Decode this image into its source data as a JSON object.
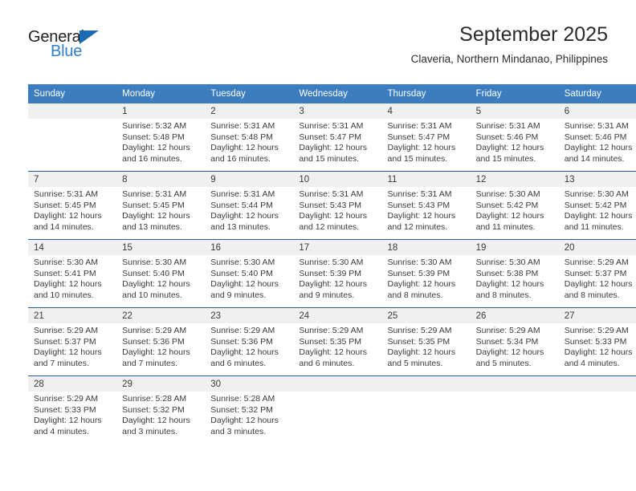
{
  "logo": {
    "word_top": "General",
    "word_bottom": "Blue",
    "triangle_color": "#1b6ab3",
    "text_color": "#231f20",
    "blue_color": "#2f7fc7"
  },
  "header": {
    "title": "September 2025",
    "subtitle": "Claveria, Northern Mindanao, Philippines"
  },
  "theme": {
    "header_bg": "#3b7dbf",
    "row_border": "#2a6099",
    "daynum_bg": "#f0f0f0",
    "text": "#3a3a3a"
  },
  "calendar": {
    "weekdays": [
      "Sunday",
      "Monday",
      "Tuesday",
      "Wednesday",
      "Thursday",
      "Friday",
      "Saturday"
    ],
    "labels": {
      "sunrise": "Sunrise:",
      "sunset": "Sunset:",
      "daylight": "Daylight:"
    },
    "weeks": [
      [
        {
          "day": "",
          "sunrise": "",
          "sunset": "",
          "daylight_line1": "",
          "daylight_line2": ""
        },
        {
          "day": "1",
          "sunrise": "Sunrise: 5:32 AM",
          "sunset": "Sunset: 5:48 PM",
          "daylight_line1": "Daylight: 12 hours",
          "daylight_line2": "and 16 minutes."
        },
        {
          "day": "2",
          "sunrise": "Sunrise: 5:31 AM",
          "sunset": "Sunset: 5:48 PM",
          "daylight_line1": "Daylight: 12 hours",
          "daylight_line2": "and 16 minutes."
        },
        {
          "day": "3",
          "sunrise": "Sunrise: 5:31 AM",
          "sunset": "Sunset: 5:47 PM",
          "daylight_line1": "Daylight: 12 hours",
          "daylight_line2": "and 15 minutes."
        },
        {
          "day": "4",
          "sunrise": "Sunrise: 5:31 AM",
          "sunset": "Sunset: 5:47 PM",
          "daylight_line1": "Daylight: 12 hours",
          "daylight_line2": "and 15 minutes."
        },
        {
          "day": "5",
          "sunrise": "Sunrise: 5:31 AM",
          "sunset": "Sunset: 5:46 PM",
          "daylight_line1": "Daylight: 12 hours",
          "daylight_line2": "and 15 minutes."
        },
        {
          "day": "6",
          "sunrise": "Sunrise: 5:31 AM",
          "sunset": "Sunset: 5:46 PM",
          "daylight_line1": "Daylight: 12 hours",
          "daylight_line2": "and 14 minutes."
        }
      ],
      [
        {
          "day": "7",
          "sunrise": "Sunrise: 5:31 AM",
          "sunset": "Sunset: 5:45 PM",
          "daylight_line1": "Daylight: 12 hours",
          "daylight_line2": "and 14 minutes."
        },
        {
          "day": "8",
          "sunrise": "Sunrise: 5:31 AM",
          "sunset": "Sunset: 5:45 PM",
          "daylight_line1": "Daylight: 12 hours",
          "daylight_line2": "and 13 minutes."
        },
        {
          "day": "9",
          "sunrise": "Sunrise: 5:31 AM",
          "sunset": "Sunset: 5:44 PM",
          "daylight_line1": "Daylight: 12 hours",
          "daylight_line2": "and 13 minutes."
        },
        {
          "day": "10",
          "sunrise": "Sunrise: 5:31 AM",
          "sunset": "Sunset: 5:43 PM",
          "daylight_line1": "Daylight: 12 hours",
          "daylight_line2": "and 12 minutes."
        },
        {
          "day": "11",
          "sunrise": "Sunrise: 5:31 AM",
          "sunset": "Sunset: 5:43 PM",
          "daylight_line1": "Daylight: 12 hours",
          "daylight_line2": "and 12 minutes."
        },
        {
          "day": "12",
          "sunrise": "Sunrise: 5:30 AM",
          "sunset": "Sunset: 5:42 PM",
          "daylight_line1": "Daylight: 12 hours",
          "daylight_line2": "and 11 minutes."
        },
        {
          "day": "13",
          "sunrise": "Sunrise: 5:30 AM",
          "sunset": "Sunset: 5:42 PM",
          "daylight_line1": "Daylight: 12 hours",
          "daylight_line2": "and 11 minutes."
        }
      ],
      [
        {
          "day": "14",
          "sunrise": "Sunrise: 5:30 AM",
          "sunset": "Sunset: 5:41 PM",
          "daylight_line1": "Daylight: 12 hours",
          "daylight_line2": "and 10 minutes."
        },
        {
          "day": "15",
          "sunrise": "Sunrise: 5:30 AM",
          "sunset": "Sunset: 5:40 PM",
          "daylight_line1": "Daylight: 12 hours",
          "daylight_line2": "and 10 minutes."
        },
        {
          "day": "16",
          "sunrise": "Sunrise: 5:30 AM",
          "sunset": "Sunset: 5:40 PM",
          "daylight_line1": "Daylight: 12 hours",
          "daylight_line2": "and 9 minutes."
        },
        {
          "day": "17",
          "sunrise": "Sunrise: 5:30 AM",
          "sunset": "Sunset: 5:39 PM",
          "daylight_line1": "Daylight: 12 hours",
          "daylight_line2": "and 9 minutes."
        },
        {
          "day": "18",
          "sunrise": "Sunrise: 5:30 AM",
          "sunset": "Sunset: 5:39 PM",
          "daylight_line1": "Daylight: 12 hours",
          "daylight_line2": "and 8 minutes."
        },
        {
          "day": "19",
          "sunrise": "Sunrise: 5:30 AM",
          "sunset": "Sunset: 5:38 PM",
          "daylight_line1": "Daylight: 12 hours",
          "daylight_line2": "and 8 minutes."
        },
        {
          "day": "20",
          "sunrise": "Sunrise: 5:29 AM",
          "sunset": "Sunset: 5:37 PM",
          "daylight_line1": "Daylight: 12 hours",
          "daylight_line2": "and 8 minutes."
        }
      ],
      [
        {
          "day": "21",
          "sunrise": "Sunrise: 5:29 AM",
          "sunset": "Sunset: 5:37 PM",
          "daylight_line1": "Daylight: 12 hours",
          "daylight_line2": "and 7 minutes."
        },
        {
          "day": "22",
          "sunrise": "Sunrise: 5:29 AM",
          "sunset": "Sunset: 5:36 PM",
          "daylight_line1": "Daylight: 12 hours",
          "daylight_line2": "and 7 minutes."
        },
        {
          "day": "23",
          "sunrise": "Sunrise: 5:29 AM",
          "sunset": "Sunset: 5:36 PM",
          "daylight_line1": "Daylight: 12 hours",
          "daylight_line2": "and 6 minutes."
        },
        {
          "day": "24",
          "sunrise": "Sunrise: 5:29 AM",
          "sunset": "Sunset: 5:35 PM",
          "daylight_line1": "Daylight: 12 hours",
          "daylight_line2": "and 6 minutes."
        },
        {
          "day": "25",
          "sunrise": "Sunrise: 5:29 AM",
          "sunset": "Sunset: 5:35 PM",
          "daylight_line1": "Daylight: 12 hours",
          "daylight_line2": "and 5 minutes."
        },
        {
          "day": "26",
          "sunrise": "Sunrise: 5:29 AM",
          "sunset": "Sunset: 5:34 PM",
          "daylight_line1": "Daylight: 12 hours",
          "daylight_line2": "and 5 minutes."
        },
        {
          "day": "27",
          "sunrise": "Sunrise: 5:29 AM",
          "sunset": "Sunset: 5:33 PM",
          "daylight_line1": "Daylight: 12 hours",
          "daylight_line2": "and 4 minutes."
        }
      ],
      [
        {
          "day": "28",
          "sunrise": "Sunrise: 5:29 AM",
          "sunset": "Sunset: 5:33 PM",
          "daylight_line1": "Daylight: 12 hours",
          "daylight_line2": "and 4 minutes."
        },
        {
          "day": "29",
          "sunrise": "Sunrise: 5:28 AM",
          "sunset": "Sunset: 5:32 PM",
          "daylight_line1": "Daylight: 12 hours",
          "daylight_line2": "and 3 minutes."
        },
        {
          "day": "30",
          "sunrise": "Sunrise: 5:28 AM",
          "sunset": "Sunset: 5:32 PM",
          "daylight_line1": "Daylight: 12 hours",
          "daylight_line2": "and 3 minutes."
        },
        {
          "day": "",
          "sunrise": "",
          "sunset": "",
          "daylight_line1": "",
          "daylight_line2": ""
        },
        {
          "day": "",
          "sunrise": "",
          "sunset": "",
          "daylight_line1": "",
          "daylight_line2": ""
        },
        {
          "day": "",
          "sunrise": "",
          "sunset": "",
          "daylight_line1": "",
          "daylight_line2": ""
        },
        {
          "day": "",
          "sunrise": "",
          "sunset": "",
          "daylight_line1": "",
          "daylight_line2": ""
        }
      ]
    ]
  }
}
